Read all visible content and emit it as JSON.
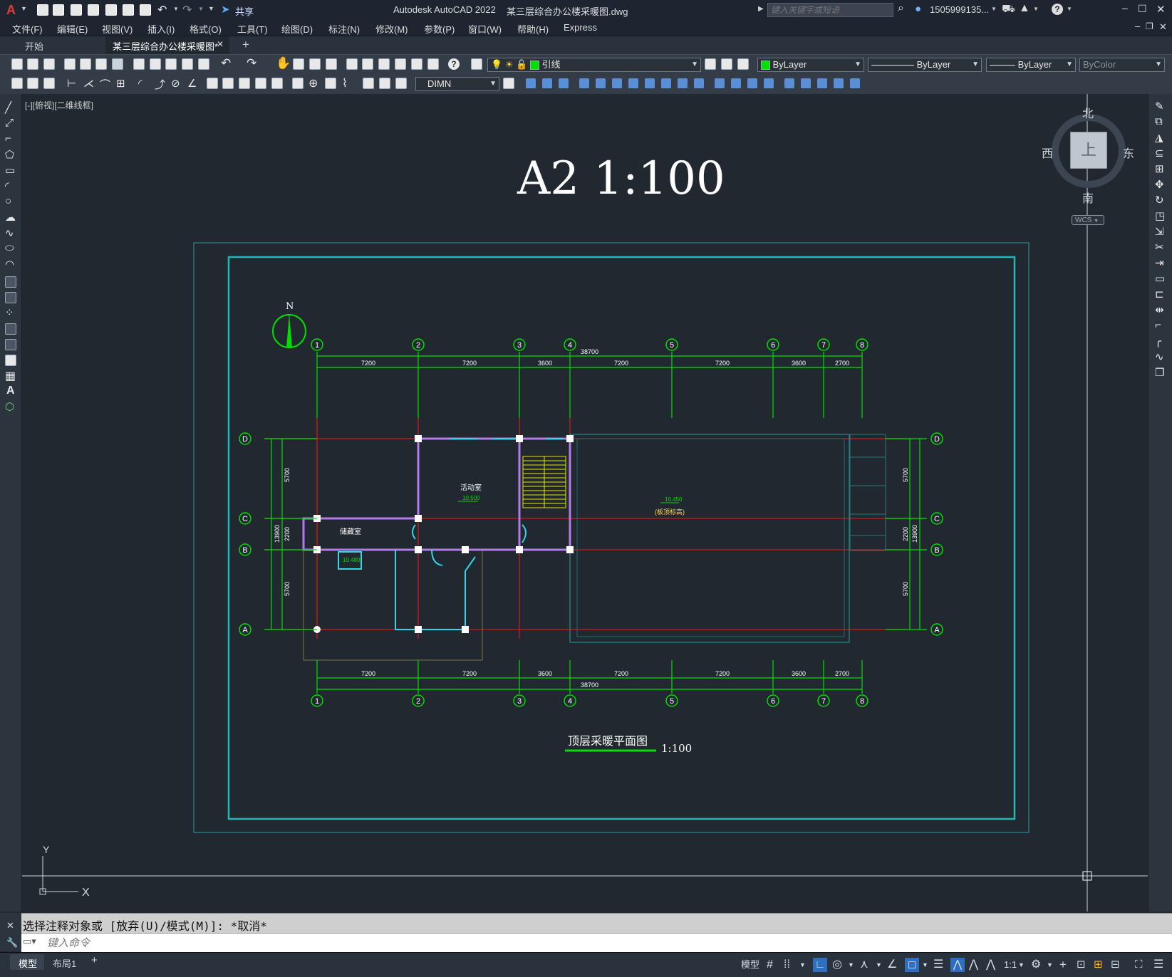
{
  "app": {
    "logo": "A",
    "title": "Autodesk AutoCAD 2022",
    "filename": "某三层综合办公楼采暖图.dwg",
    "share_label": "共享",
    "search_placeholder": "键入关键字或短语",
    "user": "1505999135...",
    "help_icon": "?"
  },
  "menu": [
    "文件(F)",
    "编辑(E)",
    "视图(V)",
    "插入(I)",
    "格式(O)",
    "工具(T)",
    "绘图(D)",
    "标注(N)",
    "修改(M)",
    "参数(P)",
    "窗口(W)",
    "帮助(H)",
    "Express"
  ],
  "tabs": {
    "start": "开始",
    "active": "某三层综合办公楼采暖图*",
    "close": "✕",
    "add": "+"
  },
  "toolbar": {
    "layer": "引线",
    "color": "ByLayer",
    "linetype": "ByLayer",
    "lineweight": "ByLayer",
    "plotstyle": "ByColor",
    "dimstyle": "DIMN"
  },
  "viewport": {
    "label": "[-][俯视][二维线框]"
  },
  "viewcube": {
    "north": "北",
    "south": "南",
    "east": "东",
    "west": "西",
    "top": "上",
    "wcs": "WCS"
  },
  "ucs": {
    "x": "X",
    "y": "Y"
  },
  "drawing": {
    "title": "A2  1:100",
    "north_arrow": "N",
    "axes_top": [
      "1",
      "2",
      "3",
      "4",
      "5",
      "6",
      "7",
      "8"
    ],
    "axes_side": [
      "D",
      "C",
      "B",
      "A"
    ],
    "dims_top": [
      "7200",
      "7200",
      "3600",
      "7200",
      "7200",
      "3600",
      "2700"
    ],
    "total": "38700",
    "dims_left": [
      "5700",
      "2200",
      "5700"
    ],
    "total_left": "13900",
    "room1": "活动室",
    "level1": "10.500",
    "room2": "储藏室",
    "level2": "10.480",
    "level3": "10.450",
    "level3_note": "(板顶标高)",
    "caption": "顶层采暖平面图",
    "caption_scale": "1:100"
  },
  "command": {
    "history": "选择注释对象或 [放弃(U)/模式(M)]: *取消*",
    "placeholder": "键入命令"
  },
  "status": {
    "model_tab": "模型",
    "layout_tab": "布局1",
    "add": "+",
    "model_btn": "模型",
    "scale": "1:1"
  }
}
